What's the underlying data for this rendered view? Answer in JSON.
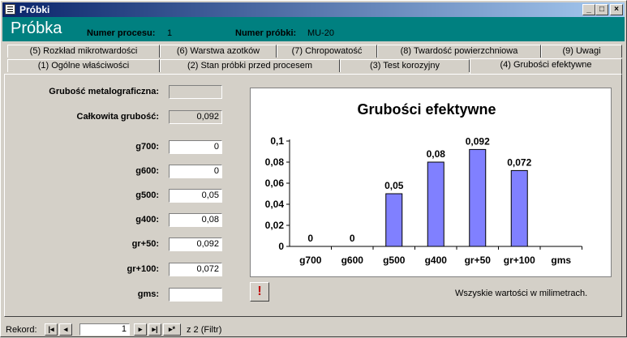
{
  "window": {
    "title": "Próbki"
  },
  "header": {
    "form_title": "Próbka",
    "process_label": "Numer procesu:",
    "process_value": "1",
    "sample_label": "Numer próbki:",
    "sample_value": "MU-20"
  },
  "tabs_back": [
    {
      "label": "(5) Rozkład mikrotwardości"
    },
    {
      "label": "(6) Warstwa azotków"
    },
    {
      "label": "(7) Chropowatość"
    },
    {
      "label": "(8) Twardość powierzchniowa"
    },
    {
      "label": "(9) Uwagi"
    }
  ],
  "tabs_front": [
    {
      "label": "(1) Ogólne właściwości"
    },
    {
      "label": "(2) Stan próbki przed procesem"
    },
    {
      "label": "(3) Test korozyjny"
    },
    {
      "label": "(4) Grubości efektywne"
    }
  ],
  "active_tab": "(4) Grubości efektywne",
  "fields": {
    "metallographic_label": "Grubość metalograficzna:",
    "metallographic_value": "",
    "total_label": "Całkowita grubość:",
    "total_value": "0,092",
    "g700_label": "g700:",
    "g700_value": "0",
    "g600_label": "g600:",
    "g600_value": "0",
    "g500_label": "g500:",
    "g500_value": "0,05",
    "g400_label": "g400:",
    "g400_value": "0,08",
    "gr50_label": "gr+50:",
    "gr50_value": "0,092",
    "gr100_label": "gr+100:",
    "gr100_value": "0,072",
    "gms_label": "gms:",
    "gms_value": ""
  },
  "note": "Wszyskie wartości w milimetrach.",
  "warning_icon": "exclamation-icon",
  "navigation": {
    "record_label": "Rekord:",
    "record_value": "1",
    "of_text": "z 2 (Filtr)"
  },
  "chart_data": {
    "type": "bar",
    "title": "Grubości efektywne",
    "categories": [
      "g700",
      "g600",
      "g500",
      "g400",
      "gr+50",
      "gr+100",
      "gms"
    ],
    "values": [
      0,
      0,
      0.05,
      0.08,
      0.092,
      0.072,
      null
    ],
    "data_labels": [
      "0",
      "0",
      "0,05",
      "0,08",
      "0,092",
      "0,072",
      ""
    ],
    "yticks": [
      "0",
      "0,02",
      "0,04",
      "0,06",
      "0,08",
      "0,1"
    ],
    "ylim": [
      0,
      0.1
    ],
    "bar_color": "#8080ff",
    "grid": false,
    "legend": "none"
  }
}
